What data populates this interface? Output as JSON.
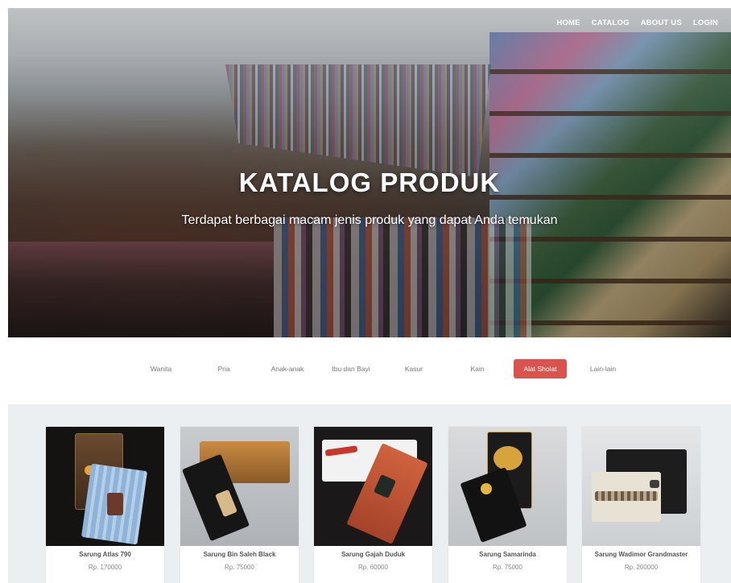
{
  "nav": {
    "items": [
      "HOME",
      "CATALOG",
      "ABOUT US",
      "LOGIN"
    ]
  },
  "hero": {
    "title": "KATALOG PRODUK",
    "subtitle": "Terdapat berbagai macam jenis produk yang dapat Anda temukan"
  },
  "categories": {
    "items": [
      "Wanita",
      "Pria",
      "Anak-anak",
      "Ibu dan Bayi",
      "Kasur",
      "Kain",
      "Alat Sholat",
      "Lain-lain"
    ],
    "active": "Alat Sholat"
  },
  "products": [
    {
      "name": "Sarung Atlas 790",
      "price": "Rp. 170000"
    },
    {
      "name": "Sarung Bin Saleh Black",
      "price": "Rp. 75000"
    },
    {
      "name": "Sarung Gajah Duduk",
      "price": "Rp. 60000"
    },
    {
      "name": "Sarung Samarinda",
      "price": "Rp. 75000"
    },
    {
      "name": "Sarung Wadimor Grandmaster",
      "price": "Rp. 200000"
    }
  ],
  "colors": {
    "active_tab": "#d9534f",
    "products_bg": "#eceff1"
  }
}
